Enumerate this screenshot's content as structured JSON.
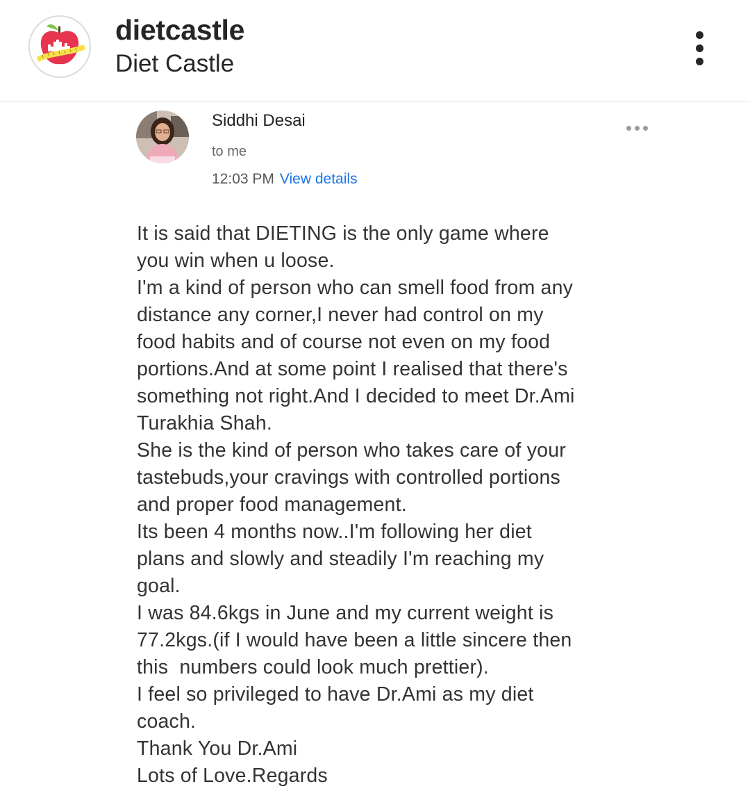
{
  "post_header": {
    "username": "dietcastle",
    "display_name": "Diet Castle",
    "logo_icon": "apple-castle-logo-icon",
    "more_icon": "vertical-ellipsis-icon"
  },
  "email": {
    "sender_name": "Siddhi Desai",
    "recipient": "to me",
    "time": "12:03 PM",
    "view_details_label": "View details",
    "menu_icon": "horizontal-ellipsis-icon",
    "link_color": "#1a73e8",
    "body_lines": [
      "It is said that DIETING is the only game where",
      "you win when u loose.",
      "I'm a kind of person who can smell food from any",
      "distance any corner,I never had control on my",
      "food habits and of course not even on my food",
      "portions.And at some point I realised that there's",
      "something not right.And I decided to meet Dr.Ami",
      "Turakhia Shah.",
      "She is the kind of person who takes care of your",
      "tastebuds,your cravings with controlled portions",
      "and proper food management.",
      "Its been 4 months now..I'm following her diet",
      "plans and slowly and steadily I'm reaching my",
      "goal.",
      "I was 84.6kgs in June and my current weight is",
      "77.2kgs.(if I would have been a little sincere then",
      "this  numbers could look much prettier).",
      "I feel so privileged to have Dr.Ami as my diet",
      "coach.",
      "Thank You Dr.Ami",
      "Lots of Love.Regards"
    ]
  }
}
